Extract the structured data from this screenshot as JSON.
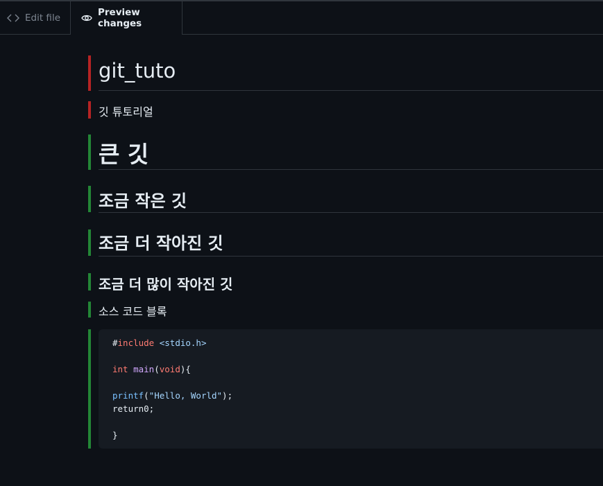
{
  "tabs": {
    "edit_label": "Edit file",
    "preview_label": "Preview changes"
  },
  "doc": {
    "title": "git_tuto",
    "subtitle": "깃 튜토리얼",
    "h1": "큰 깃",
    "h2": "조금 작은 깃",
    "h3": "조금 더 작아진 깃",
    "h4": "조금 더 많이 작아진 깃",
    "code_caption": "소스 코드 블록"
  },
  "code": {
    "line1_hash": "#",
    "line1_kw": "include",
    "line1_header": "<stdio.h>",
    "line2_type": "int",
    "line2_fn": "main",
    "line2_open": "(",
    "line2_param": "void",
    "line2_close": "){",
    "line3_call": "printf",
    "line3_open": "(",
    "line3_str": "\"Hello, World\"",
    "line3_close": ");",
    "line4": "return0;",
    "line5": "}"
  },
  "colors": {
    "deleted_bar": "#b62324",
    "added_bar": "#238636",
    "background": "#0d1117",
    "code_background": "#161b22"
  }
}
